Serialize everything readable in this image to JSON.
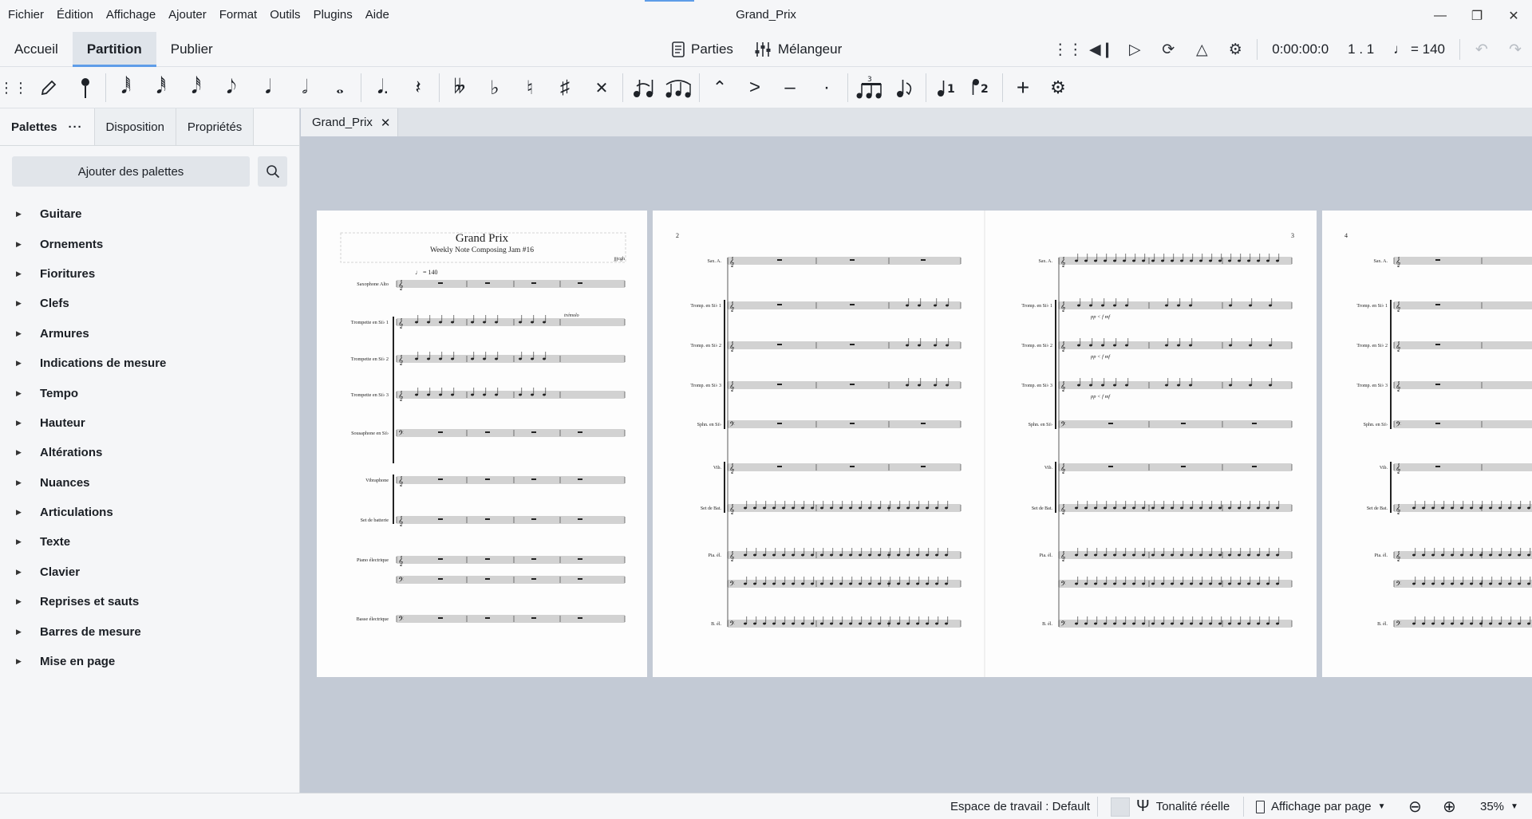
{
  "menubar": {
    "menus": [
      "Fichier",
      "Édition",
      "Affichage",
      "Ajouter",
      "Format",
      "Outils",
      "Plugins",
      "Aide"
    ],
    "window_title": "Grand_Prix"
  },
  "workspace_tabs": [
    "Accueil",
    "Partition",
    "Publier"
  ],
  "center_tools": {
    "parts_label": "Parties",
    "mixer_label": "Mélangeur"
  },
  "playback": {
    "time": "0:00:00:0",
    "position": "1 . 1",
    "tempo": "= 140"
  },
  "palette_panel": {
    "tabs": [
      "Palettes",
      "Disposition",
      "Propriétés"
    ],
    "add_palettes_label": "Ajouter des palettes",
    "palettes": [
      "Guitare",
      "Ornements",
      "Fioritures",
      "Clefs",
      "Armures",
      "Indications de mesure",
      "Tempo",
      "Hauteur",
      "Altérations",
      "Nuances",
      "Articulations",
      "Texte",
      "Clavier",
      "Reprises et sauts",
      "Barres de mesure",
      "Mise en page"
    ]
  },
  "document_tab": {
    "label": "Grand_Prix"
  },
  "score": {
    "title": "Grand Prix",
    "subtitle": "Weekly Note Composing Jam #16",
    "composer": "jjjcgh",
    "tempo_mark": "♩ = 140",
    "tremolo_text": "trémolo",
    "page_numbers": [
      "2",
      "3",
      "4"
    ],
    "page1_instruments": [
      "Saxophone Alto",
      "Trompette en Si♭ 1",
      "Trompette en Si♭ 2",
      "Trompette en Si♭ 3",
      "Sousaphone en Si♭",
      "Vibraphone",
      "Set de batterie",
      "Piano électrique",
      "Basse électrique"
    ],
    "short_instruments": [
      "Sax. A.",
      "Tromp. en Si♭ 1",
      "Tromp. en Si♭ 2",
      "Tromp. en Si♭ 3",
      "Sphn. en Si♭",
      "Vib.",
      "Set de Bat.",
      "Pia. él.",
      "B. él."
    ],
    "dynamics": "pp < f  mf"
  },
  "statusbar": {
    "workspace": "Espace de travail : Default",
    "concert_pitch": "Tonalité réelle",
    "view_mode": "Affichage par page",
    "zoom": "35%"
  }
}
